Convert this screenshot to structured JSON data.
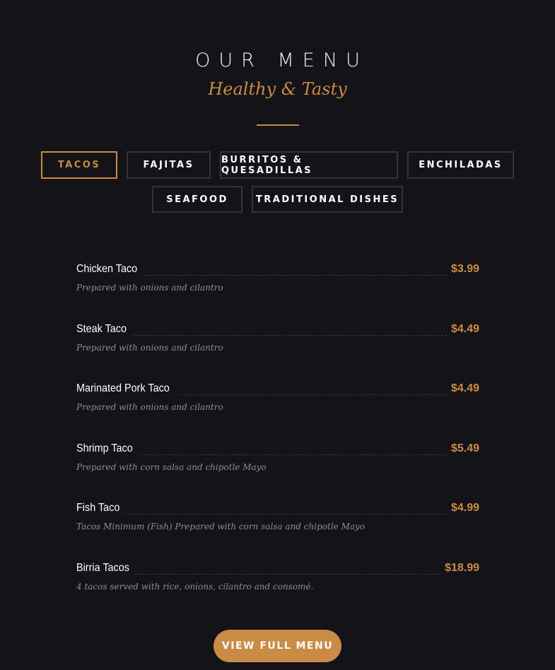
{
  "header": {
    "title": "OUR MENU",
    "subtitle": "Healthy & Tasty"
  },
  "tabs": [
    {
      "label": "TACOS",
      "active": true
    },
    {
      "label": "FAJITAS",
      "active": false
    },
    {
      "label": "BURRITOS & QUESADILLAS",
      "active": false
    },
    {
      "label": "ENCHILADAS",
      "active": false
    },
    {
      "label": "SEAFOOD",
      "active": false
    },
    {
      "label": "TRADITIONAL DISHES",
      "active": false
    }
  ],
  "menu_items": [
    {
      "name": "Chicken Taco",
      "price": "$3.99",
      "description": "Prepared with onions and cilantro"
    },
    {
      "name": "Steak Taco",
      "price": "$4.49",
      "description": "Prepared with onions and cilantro"
    },
    {
      "name": "Marinated Pork Taco",
      "price": "$4.49",
      "description": "Prepared with onions and cilantro"
    },
    {
      "name": "Shrimp Taco",
      "price": "$5.49",
      "description": "Prepared with corn salsa and chipotle Mayo"
    },
    {
      "name": "Fish Taco",
      "price": "$4.99",
      "description": "Tacos Minimum (Fish) Prepared with corn salsa and chipotle Mayo"
    },
    {
      "name": "Birria Tacos",
      "price": "$18.99",
      "description": "4 tacos served with rice, onions, cilantro and consomé."
    }
  ],
  "cta": {
    "label": "VIEW FULL MENU"
  },
  "colors": {
    "background": "#141317",
    "accent": "#c98b45",
    "muted_text": "#8e8d93"
  }
}
